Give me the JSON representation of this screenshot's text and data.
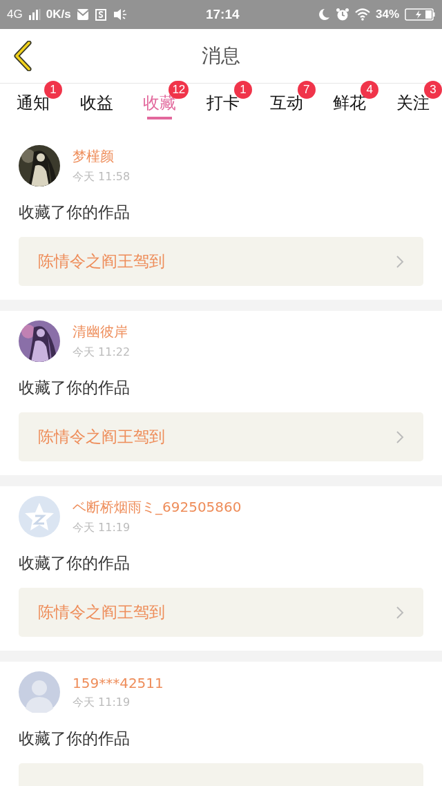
{
  "status_bar": {
    "network": "4G",
    "speed": "0K/s",
    "time": "17:14",
    "battery": "34%"
  },
  "header": {
    "title": "消息"
  },
  "tabs": [
    {
      "label": "通知",
      "badge": "1",
      "selected": false
    },
    {
      "label": "收益",
      "selected": false
    },
    {
      "label": "收藏",
      "badge": "12",
      "selected": true
    },
    {
      "label": "打卡",
      "badge": "1",
      "selected": false
    },
    {
      "label": "互动",
      "badge": "7",
      "selected": false
    },
    {
      "label": "鲜花",
      "badge": "4",
      "selected": false
    },
    {
      "label": "关注",
      "badge": "3",
      "selected": false
    }
  ],
  "messages": [
    {
      "kind": "picture",
      "name": "梦槿颜",
      "time": "今天 11:58",
      "action": "收藏了你的作品",
      "work": "陈情令之阎王驾到"
    },
    {
      "kind": "picture",
      "name": "清幽彼岸",
      "time": "今天 11:22",
      "action": "收藏了你的作品",
      "work": "陈情令之阎王驾到"
    },
    {
      "kind": "star",
      "name": "ベ断桥烟雨ミ_692505860",
      "time": "今天 11:19",
      "action": "收藏了你的作品",
      "work": "陈情令之阎王驾到"
    },
    {
      "kind": "person",
      "name": "159***42511",
      "time": "今天 11:19",
      "action": "收藏了你的作品"
    }
  ]
}
